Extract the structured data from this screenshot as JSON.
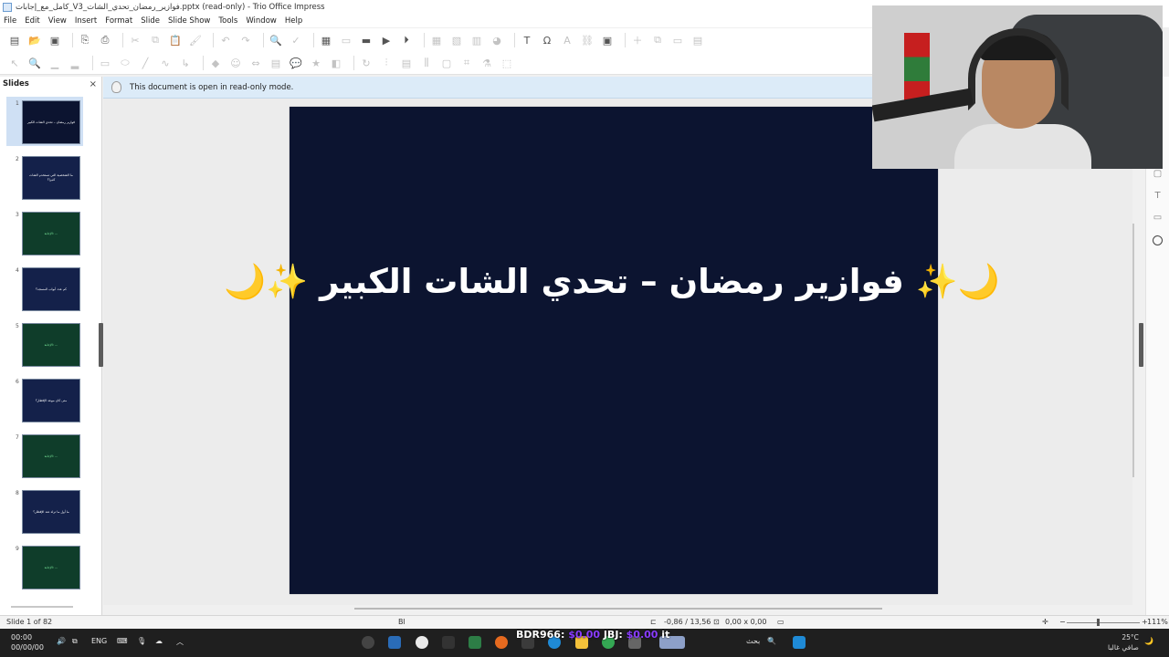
{
  "window": {
    "title": "كامل_مع_إجابات_V3_فوازير_رمضان_تحدي_الشات.pptx (read-only) - Trio Office Impress"
  },
  "menu": [
    "File",
    "Edit",
    "View",
    "Insert",
    "Format",
    "Slide",
    "Slide Show",
    "Tools",
    "Window",
    "Help"
  ],
  "slides_panel": {
    "title": "Slides",
    "close_glyph": "×",
    "thumbnails": [
      {
        "num": "1",
        "text": "فوازير رمضان – تحدي الشات الكبير",
        "theme": "navy"
      },
      {
        "num": "2",
        "text": "ما الشخصية التي تستخدم الشات كثيرا؟",
        "theme": "navy2"
      },
      {
        "num": "3",
        "text": "الإجابة: ...",
        "theme": "green"
      },
      {
        "num": "4",
        "text": "كم عدد أبواب المسجد؟",
        "theme": "navy2"
      },
      {
        "num": "5",
        "text": "الإجابة: ...",
        "theme": "green"
      },
      {
        "num": "6",
        "text": "متى كان موعد الإفطار؟",
        "theme": "navy2"
      },
      {
        "num": "7",
        "text": "الإجابة: ...",
        "theme": "green"
      },
      {
        "num": "8",
        "text": "ما أول ما تراه عند الإفطار؟",
        "theme": "navy2"
      },
      {
        "num": "9",
        "text": "الإجابة: ...",
        "theme": "green"
      }
    ]
  },
  "infobar": {
    "message": "This document is open in read-only mode."
  },
  "slide": {
    "title": "🌙✨ فوازير رمضان – تحدي الشات الكبير ✨🌙",
    "background": "#0c1430"
  },
  "status": {
    "slide_info": "Slide 1 of 82",
    "layout": "Bl",
    "position": "-0,86 / 13,56",
    "size": "0,00 x 0,00",
    "zoom": "111%"
  },
  "taskbar": {
    "time": "00:00",
    "date": "00/00/00",
    "lang": "ENG",
    "search": "بحث",
    "weather_temp": "25°C",
    "weather_desc": "صافي غالبا",
    "overlay_label_1": "BDR966:",
    "overlay_amount_1": "$0.00",
    "overlay_label_2": "JBJ:",
    "overlay_amount_2": "$0.00",
    "overlay_tail": "it"
  }
}
